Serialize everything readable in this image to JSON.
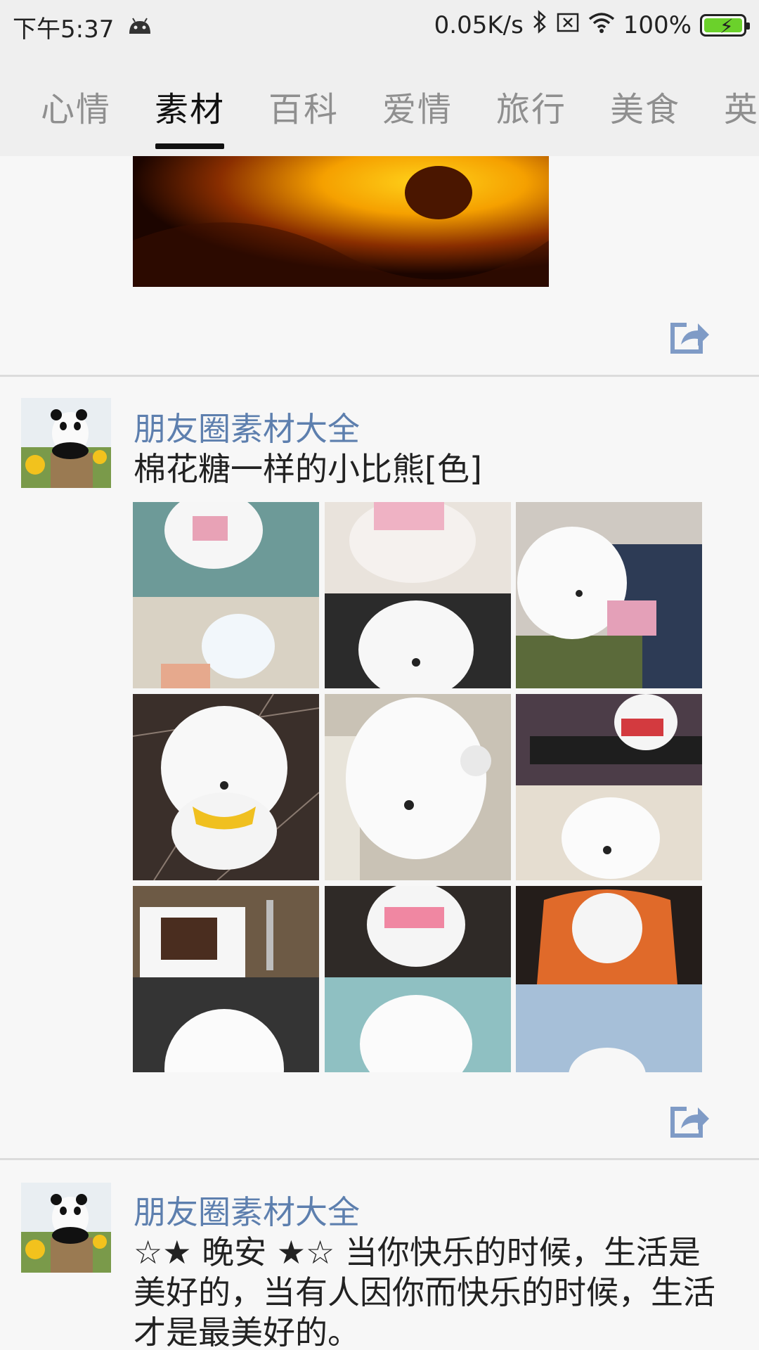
{
  "status_bar": {
    "time": "下午5:37",
    "network_speed": "0.05K/s",
    "battery": "100%"
  },
  "tabs": [
    {
      "label": "心情"
    },
    {
      "label": "素材"
    },
    {
      "label": "百科"
    },
    {
      "label": "爱情"
    },
    {
      "label": "旅行"
    },
    {
      "label": "美食"
    },
    {
      "label": "英"
    }
  ],
  "active_tab": "素材",
  "posts": [
    {
      "author": "朋友圈素材大全",
      "text": "棉花糖一样的小比熊[色]",
      "image_count": 9
    },
    {
      "author": "朋友圈素材大全",
      "text": "☆★ 晚安 ★☆ 当你快乐的时候，生活是美好的，当有人因你而快乐的时候，生活才是最美好的。"
    }
  ],
  "icons": {
    "share": "share-icon",
    "wifi": "wifi-icon",
    "bluetooth": "bluetooth-icon",
    "sim": "sim-icon",
    "android": "android-icon"
  },
  "colors": {
    "accent_author": "#5d7fae",
    "share_icon": "#7f9bc6",
    "battery_green": "#6bd12b"
  }
}
